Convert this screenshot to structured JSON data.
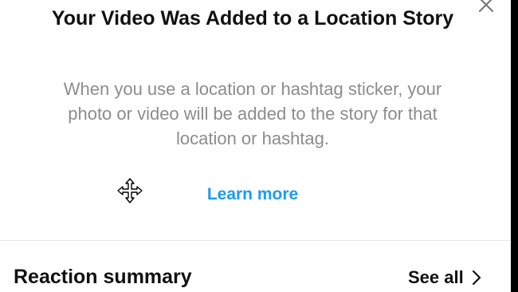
{
  "dialog": {
    "title": "Your Video Was Added to a Location Story",
    "description": "When you use a location or hashtag sticker, your photo or video will be added to the story for that location or hashtag.",
    "link_label": "Learn more",
    "close_icon": "close-icon"
  },
  "reactions": {
    "section_title": "Reaction summary",
    "see_all_label": "See all",
    "see_all_icon": "chevron-right-icon"
  },
  "cursor": {
    "icon": "move-cursor-icon"
  },
  "colors": {
    "link": "#1d9bf0",
    "title_text": "#111111",
    "description_text": "#8c8c8c",
    "divider": "#e6e6e6",
    "background": "#ffffff",
    "edge": "#000000"
  }
}
